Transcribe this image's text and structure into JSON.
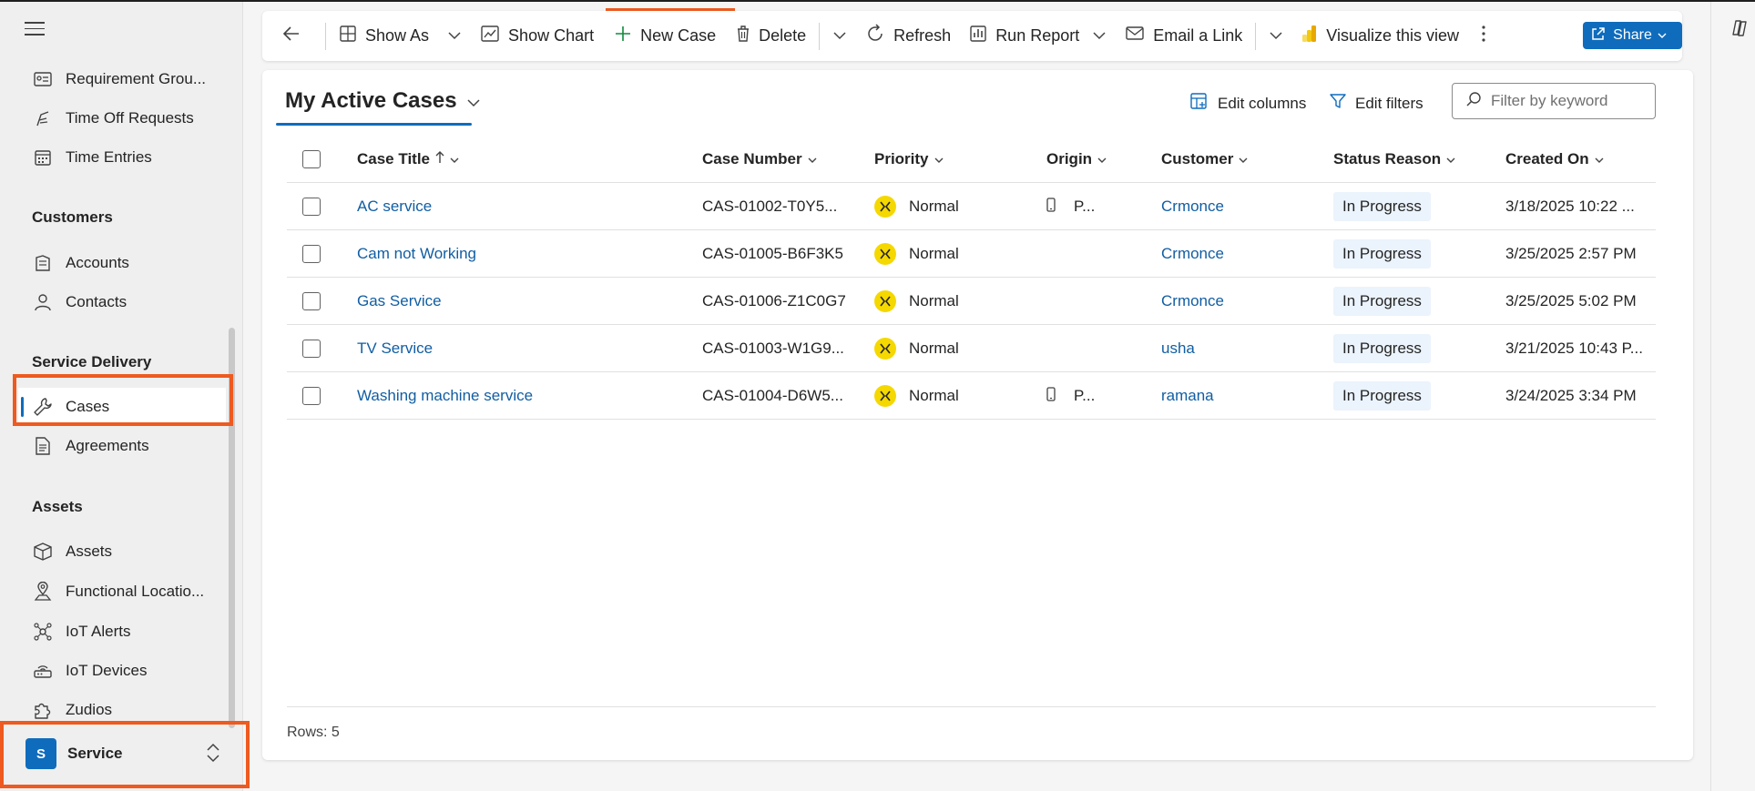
{
  "sidebar": {
    "menu_icon": "hamburger-icon",
    "items_top": [
      {
        "label": "Requirement Grou...",
        "icon": "requirement-group-icon"
      },
      {
        "label": "Time Off Requests",
        "icon": "time-off-icon"
      },
      {
        "label": "Time Entries",
        "icon": "calendar-icon"
      }
    ],
    "sections": {
      "customers": {
        "title": "Customers",
        "items": [
          {
            "label": "Accounts",
            "icon": "account-icon"
          },
          {
            "label": "Contacts",
            "icon": "person-icon"
          }
        ]
      },
      "service_delivery": {
        "title": "Service Delivery",
        "items": [
          {
            "label": "Cases",
            "icon": "wrench-icon"
          },
          {
            "label": "Agreements",
            "icon": "document-icon"
          }
        ]
      },
      "assets": {
        "title": "Assets",
        "items": [
          {
            "label": "Assets",
            "icon": "cube-icon"
          },
          {
            "label": "Functional Locatio...",
            "icon": "location-icon"
          },
          {
            "label": "IoT Alerts",
            "icon": "iot-alert-icon"
          },
          {
            "label": "IoT Devices",
            "icon": "router-icon"
          },
          {
            "label": "Zudios",
            "icon": "puzzle-icon"
          }
        ]
      }
    },
    "area": {
      "badge": "S",
      "label": "Service"
    }
  },
  "commandbar": {
    "back_icon": "arrow-left-icon",
    "show_as": "Show As",
    "show_chart": "Show Chart",
    "new_case": "New Case",
    "delete": "Delete",
    "refresh": "Refresh",
    "run_report": "Run Report",
    "email_link": "Email a Link",
    "visualize": "Visualize this view",
    "share": "Share"
  },
  "view": {
    "title": "My Active Cases",
    "edit_columns": "Edit columns",
    "edit_filters": "Edit filters",
    "filter_placeholder": "Filter by keyword"
  },
  "grid": {
    "columns": {
      "case_title": "Case Title",
      "case_number": "Case Number",
      "priority": "Priority",
      "origin": "Origin",
      "customer": "Customer",
      "status_reason": "Status Reason",
      "created_on": "Created On"
    },
    "rows": [
      {
        "title": "AC service",
        "number": "CAS-01002-T0Y5...",
        "priority": "Normal",
        "origin": "P...",
        "customer": "Crmonce",
        "status": "In Progress",
        "created": "3/18/2025 10:22 ..."
      },
      {
        "title": "Cam not Working",
        "number": "CAS-01005-B6F3K5",
        "priority": "Normal",
        "origin": "",
        "customer": "Crmonce",
        "status": "In Progress",
        "created": "3/25/2025 2:57 PM"
      },
      {
        "title": "Gas Service",
        "number": "CAS-01006-Z1C0G7",
        "priority": "Normal",
        "origin": "",
        "customer": "Crmonce",
        "status": "In Progress",
        "created": "3/25/2025 5:02 PM"
      },
      {
        "title": "TV Service",
        "number": "CAS-01003-W1G9...",
        "priority": "Normal",
        "origin": "",
        "customer": "usha",
        "status": "In Progress",
        "created": "3/21/2025 10:43 P..."
      },
      {
        "title": "Washing machine service",
        "number": "CAS-01004-D6W5...",
        "priority": "Normal",
        "origin": "P...",
        "customer": "ramana",
        "status": "In Progress",
        "created": "3/24/2025 3:34 PM"
      }
    ],
    "rows_label": "Rows: 5"
  },
  "colors": {
    "accent": "#0f6cbd",
    "highlight": "#ee5a1f",
    "priority_normal": "#f5d800"
  }
}
